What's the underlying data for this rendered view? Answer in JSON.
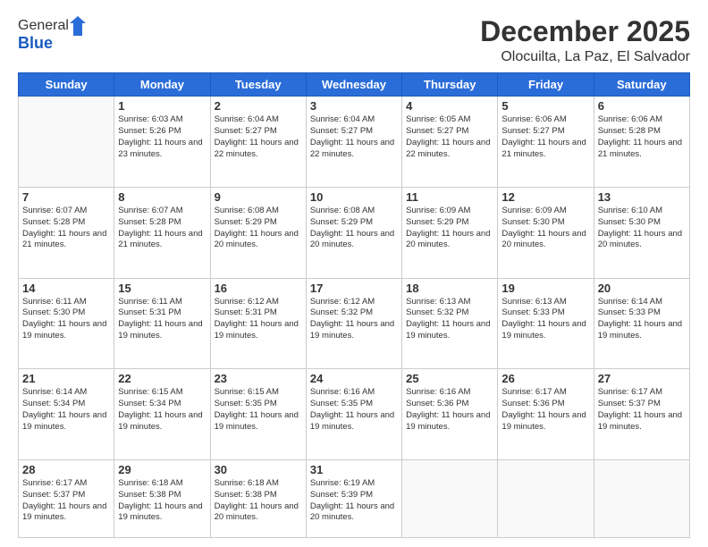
{
  "header": {
    "logo_general": "General",
    "logo_blue": "Blue",
    "month_title": "December 2025",
    "location": "Olocuilta, La Paz, El Salvador"
  },
  "days": [
    "Sunday",
    "Monday",
    "Tuesday",
    "Wednesday",
    "Thursday",
    "Friday",
    "Saturday"
  ],
  "weeks": [
    [
      {
        "num": "",
        "sunrise": "",
        "sunset": "",
        "daylight": ""
      },
      {
        "num": "1",
        "sunrise": "6:03 AM",
        "sunset": "5:26 PM",
        "daylight": "11 hours and 23 minutes."
      },
      {
        "num": "2",
        "sunrise": "6:04 AM",
        "sunset": "5:27 PM",
        "daylight": "11 hours and 22 minutes."
      },
      {
        "num": "3",
        "sunrise": "6:04 AM",
        "sunset": "5:27 PM",
        "daylight": "11 hours and 22 minutes."
      },
      {
        "num": "4",
        "sunrise": "6:05 AM",
        "sunset": "5:27 PM",
        "daylight": "11 hours and 22 minutes."
      },
      {
        "num": "5",
        "sunrise": "6:06 AM",
        "sunset": "5:27 PM",
        "daylight": "11 hours and 21 minutes."
      },
      {
        "num": "6",
        "sunrise": "6:06 AM",
        "sunset": "5:28 PM",
        "daylight": "11 hours and 21 minutes."
      }
    ],
    [
      {
        "num": "7",
        "sunrise": "6:07 AM",
        "sunset": "5:28 PM",
        "daylight": "11 hours and 21 minutes."
      },
      {
        "num": "8",
        "sunrise": "6:07 AM",
        "sunset": "5:28 PM",
        "daylight": "11 hours and 21 minutes."
      },
      {
        "num": "9",
        "sunrise": "6:08 AM",
        "sunset": "5:29 PM",
        "daylight": "11 hours and 20 minutes."
      },
      {
        "num": "10",
        "sunrise": "6:08 AM",
        "sunset": "5:29 PM",
        "daylight": "11 hours and 20 minutes."
      },
      {
        "num": "11",
        "sunrise": "6:09 AM",
        "sunset": "5:29 PM",
        "daylight": "11 hours and 20 minutes."
      },
      {
        "num": "12",
        "sunrise": "6:09 AM",
        "sunset": "5:30 PM",
        "daylight": "11 hours and 20 minutes."
      },
      {
        "num": "13",
        "sunrise": "6:10 AM",
        "sunset": "5:30 PM",
        "daylight": "11 hours and 20 minutes."
      }
    ],
    [
      {
        "num": "14",
        "sunrise": "6:11 AM",
        "sunset": "5:30 PM",
        "daylight": "11 hours and 19 minutes."
      },
      {
        "num": "15",
        "sunrise": "6:11 AM",
        "sunset": "5:31 PM",
        "daylight": "11 hours and 19 minutes."
      },
      {
        "num": "16",
        "sunrise": "6:12 AM",
        "sunset": "5:31 PM",
        "daylight": "11 hours and 19 minutes."
      },
      {
        "num": "17",
        "sunrise": "6:12 AM",
        "sunset": "5:32 PM",
        "daylight": "11 hours and 19 minutes."
      },
      {
        "num": "18",
        "sunrise": "6:13 AM",
        "sunset": "5:32 PM",
        "daylight": "11 hours and 19 minutes."
      },
      {
        "num": "19",
        "sunrise": "6:13 AM",
        "sunset": "5:33 PM",
        "daylight": "11 hours and 19 minutes."
      },
      {
        "num": "20",
        "sunrise": "6:14 AM",
        "sunset": "5:33 PM",
        "daylight": "11 hours and 19 minutes."
      }
    ],
    [
      {
        "num": "21",
        "sunrise": "6:14 AM",
        "sunset": "5:34 PM",
        "daylight": "11 hours and 19 minutes."
      },
      {
        "num": "22",
        "sunrise": "6:15 AM",
        "sunset": "5:34 PM",
        "daylight": "11 hours and 19 minutes."
      },
      {
        "num": "23",
        "sunrise": "6:15 AM",
        "sunset": "5:35 PM",
        "daylight": "11 hours and 19 minutes."
      },
      {
        "num": "24",
        "sunrise": "6:16 AM",
        "sunset": "5:35 PM",
        "daylight": "11 hours and 19 minutes."
      },
      {
        "num": "25",
        "sunrise": "6:16 AM",
        "sunset": "5:36 PM",
        "daylight": "11 hours and 19 minutes."
      },
      {
        "num": "26",
        "sunrise": "6:17 AM",
        "sunset": "5:36 PM",
        "daylight": "11 hours and 19 minutes."
      },
      {
        "num": "27",
        "sunrise": "6:17 AM",
        "sunset": "5:37 PM",
        "daylight": "11 hours and 19 minutes."
      }
    ],
    [
      {
        "num": "28",
        "sunrise": "6:17 AM",
        "sunset": "5:37 PM",
        "daylight": "11 hours and 19 minutes."
      },
      {
        "num": "29",
        "sunrise": "6:18 AM",
        "sunset": "5:38 PM",
        "daylight": "11 hours and 19 minutes."
      },
      {
        "num": "30",
        "sunrise": "6:18 AM",
        "sunset": "5:38 PM",
        "daylight": "11 hours and 20 minutes."
      },
      {
        "num": "31",
        "sunrise": "6:19 AM",
        "sunset": "5:39 PM",
        "daylight": "11 hours and 20 minutes."
      },
      {
        "num": "",
        "sunrise": "",
        "sunset": "",
        "daylight": ""
      },
      {
        "num": "",
        "sunrise": "",
        "sunset": "",
        "daylight": ""
      },
      {
        "num": "",
        "sunrise": "",
        "sunset": "",
        "daylight": ""
      }
    ]
  ]
}
